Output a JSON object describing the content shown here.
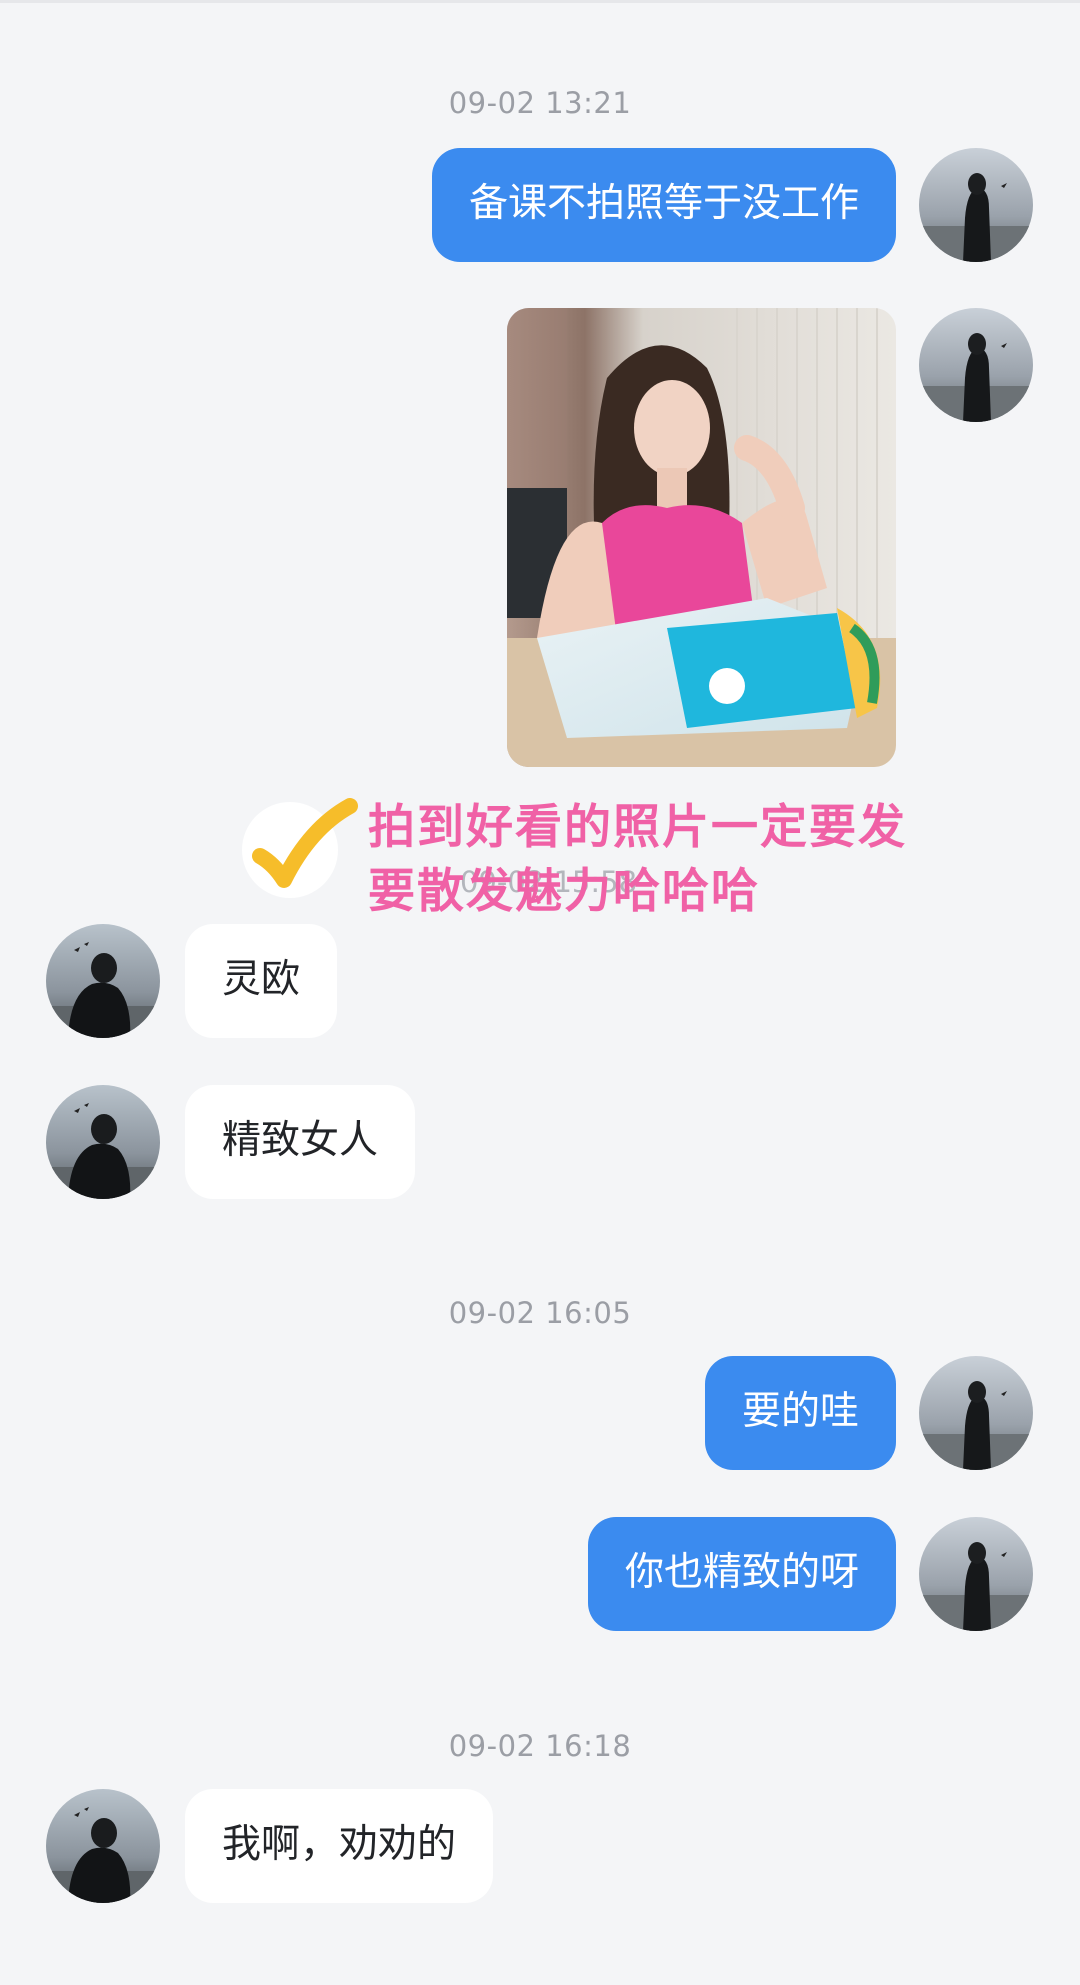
{
  "chat": {
    "timestamps": {
      "t1": "09-02 13:21",
      "t2_partial": "09-02 15:58",
      "t3": "09-02 16:05",
      "t4": "09-02 16:18"
    },
    "messages": [
      {
        "dir": "out",
        "text": "备课不拍照等于没工作"
      },
      {
        "dir": "out",
        "type": "image",
        "alt": "selfie photo"
      },
      {
        "dir": "in",
        "text": "灵欧"
      },
      {
        "dir": "in",
        "text": "精致女人"
      },
      {
        "dir": "out",
        "text": "要的哇"
      },
      {
        "dir": "out",
        "text": "你也精致的呀"
      },
      {
        "dir": "in",
        "text": "我啊，劝劝的"
      }
    ],
    "overlay": {
      "line1": "拍到好看的照片一定要发",
      "line2": "要散发魅力哈哈哈",
      "check_icon": "check-icon",
      "color": "#f061a6"
    },
    "colors": {
      "outgoing_bubble": "#3b8bef",
      "incoming_bubble": "#ffffff",
      "background": "#f4f5f7"
    }
  }
}
